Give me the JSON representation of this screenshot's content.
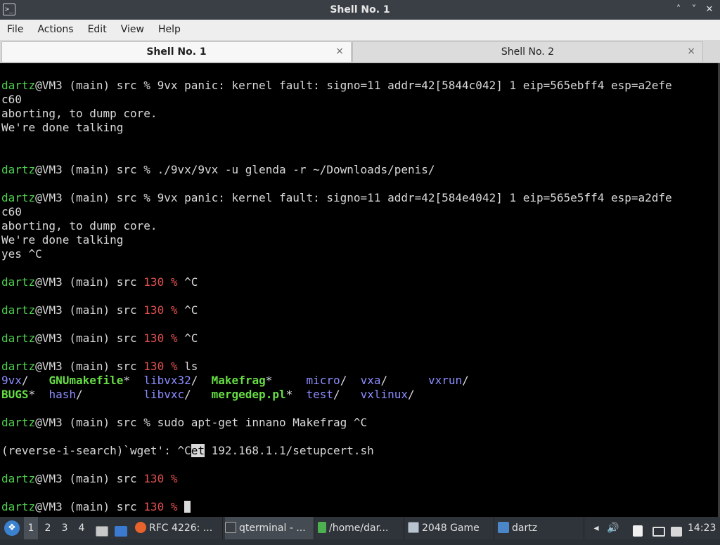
{
  "window": {
    "title": "Shell No. 1",
    "icon": "terminal-icon",
    "minimize": "˄",
    "restore": "˅",
    "close": "✕"
  },
  "menu": [
    "File",
    "Actions",
    "Edit",
    "View",
    "Help"
  ],
  "tabs": [
    {
      "label": "Shell No. 1",
      "active": true,
      "close": "×"
    },
    {
      "label": "Shell No. 2",
      "active": false,
      "close": "×"
    }
  ],
  "terminal": {
    "lines": [
      [
        [
          "p",
          "dartz"
        ],
        [
          "w",
          "@VM3 (main) src % 9vx panic: kernel fault: signo=11 addr=42[5844c042] 1 eip=565ebff4 esp=a2efe"
        ]
      ],
      [
        [
          "w",
          "c60"
        ]
      ],
      [
        [
          "w",
          "aborting, to dump core."
        ]
      ],
      [
        [
          "w",
          "We're done talking"
        ]
      ],
      [],
      [],
      [
        [
          "p",
          "dartz"
        ],
        [
          "w",
          "@VM3 (main) src % ./9vx/9vx -u glenda -r ~/Downloads/penis/"
        ]
      ],
      [],
      [
        [
          "p",
          "dartz"
        ],
        [
          "w",
          "@VM3 (main) src % 9vx panic: kernel fault: signo=11 addr=42[584e4042] 1 eip=565e5ff4 esp=a2dfe"
        ]
      ],
      [
        [
          "w",
          "c60"
        ]
      ],
      [
        [
          "w",
          "aborting, to dump core."
        ]
      ],
      [
        [
          "w",
          "We're done talking"
        ]
      ],
      [
        [
          "w",
          "yes ^C"
        ]
      ],
      [],
      [
        [
          "p",
          "dartz"
        ],
        [
          "w",
          "@VM3 (main) src "
        ],
        [
          "r",
          "130 %"
        ],
        [
          "w",
          " ^C"
        ]
      ],
      [],
      [
        [
          "p",
          "dartz"
        ],
        [
          "w",
          "@VM3 (main) src "
        ],
        [
          "r",
          "130 %"
        ],
        [
          "w",
          " ^C"
        ]
      ],
      [],
      [
        [
          "p",
          "dartz"
        ],
        [
          "w",
          "@VM3 (main) src "
        ],
        [
          "r",
          "130 %"
        ],
        [
          "w",
          " ^C"
        ]
      ],
      [],
      [
        [
          "p",
          "dartz"
        ],
        [
          "w",
          "@VM3 (main) src "
        ],
        [
          "r",
          "130 %"
        ],
        [
          "w",
          " ls"
        ]
      ],
      [
        [
          "b",
          "9vx"
        ],
        [
          "w",
          "/   "
        ],
        [
          "x",
          "GNUmakefile"
        ],
        [
          "w",
          "*  "
        ],
        [
          "b",
          "libvx32"
        ],
        [
          "w",
          "/  "
        ],
        [
          "x",
          "Makefrag"
        ],
        [
          "w",
          "*     "
        ],
        [
          "b",
          "micro"
        ],
        [
          "w",
          "/  "
        ],
        [
          "b",
          "vxa"
        ],
        [
          "w",
          "/      "
        ],
        [
          "b",
          "vxrun"
        ],
        [
          "w",
          "/"
        ]
      ],
      [
        [
          "x",
          "BUGS"
        ],
        [
          "w",
          "*  "
        ],
        [
          "b",
          "hash"
        ],
        [
          "w",
          "/         "
        ],
        [
          "b",
          "libvxc"
        ],
        [
          "w",
          "/   "
        ],
        [
          "x",
          "mergedep.pl"
        ],
        [
          "w",
          "*  "
        ],
        [
          "b",
          "test"
        ],
        [
          "w",
          "/   "
        ],
        [
          "b",
          "vxlinux"
        ],
        [
          "w",
          "/"
        ]
      ],
      [],
      [
        [
          "p",
          "dartz"
        ],
        [
          "w",
          "@VM3 (main) src % sudo apt-get innano Makefrag ^C"
        ]
      ],
      [],
      [
        [
          "w",
          "(reverse-i-search)`wget': ^C"
        ],
        [
          "s",
          "et"
        ],
        [
          "w",
          " 192.168.1.1/setupcert.sh"
        ]
      ],
      [],
      [
        [
          "p",
          "dartz"
        ],
        [
          "w",
          "@VM3 (main) src "
        ],
        [
          "r",
          "130 %"
        ]
      ],
      [],
      [
        [
          "p",
          "dartz"
        ],
        [
          "w",
          "@VM3 (main) src "
        ],
        [
          "r",
          "130 %"
        ],
        [
          "w",
          " "
        ],
        [
          "c",
          ""
        ]
      ]
    ]
  },
  "taskbar": {
    "start_icon": "start-menu-icon",
    "desktops": [
      "1",
      "2",
      "3",
      "4"
    ],
    "active_desktop": "1",
    "tasks": [
      {
        "label": "RFC 4226: ...",
        "icon": "firefox-icon",
        "color": "#e8622c"
      },
      {
        "label": "qterminal - ...",
        "icon": "terminal-icon",
        "color": "#3a3f45",
        "active": true
      },
      {
        "label": "/home/dar...",
        "icon": "file-manager-icon",
        "color": "#4caf50"
      },
      {
        "label": "2048 Game",
        "icon": "window-icon",
        "color": "#9ab"
      },
      {
        "label": "dartz",
        "icon": "folder-icon",
        "color": "#4a86c8"
      }
    ],
    "clock": "14:23"
  }
}
